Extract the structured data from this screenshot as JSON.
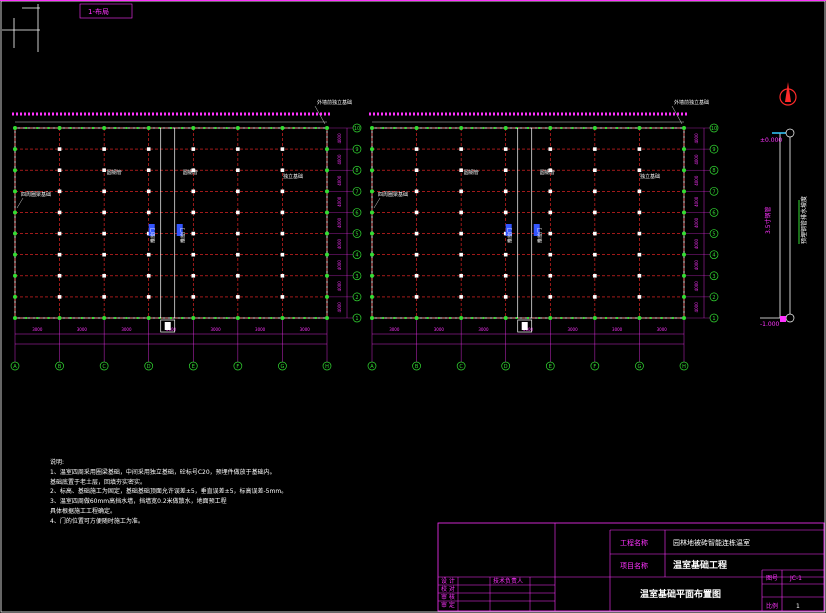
{
  "viewport_tab": "1-布局",
  "plan": {
    "exterior_wall_label": "外墙前独立基础",
    "side_wall_label": "四周圈梁基础",
    "interior_label": "独立基础",
    "column_label": "圆钢管",
    "door_label": "推拉门",
    "row_axes": [
      "10",
      "9",
      "8",
      "7",
      "6",
      "5",
      "4",
      "3",
      "2",
      "1"
    ],
    "col_axes": [
      "A",
      "B",
      "C",
      "D",
      "E",
      "F",
      "G",
      "H"
    ],
    "bay_dims": [
      "3000",
      "3000",
      "3000",
      "3000",
      "3000",
      "3000",
      "3000",
      "3000"
    ],
    "row_dims": [
      "4000",
      "4000",
      "4000",
      "4000",
      "4000",
      "4000",
      "4000",
      "4000",
      "4000"
    ]
  },
  "section": {
    "elev_top": "±0.000",
    "elev_bottom": "-1.000",
    "pipe_label": "3.5寸钢管",
    "slope_label": "预埋钢管排水坡度"
  },
  "notes": {
    "title": "说明:",
    "lines": [
      "1、温室四周采用圈梁基础，中间采用独立基础，砼标号C20，预埋件做放于基础内。",
      "   基础底置于老土层，回填夯实密实。",
      "2、标高、基础施工为固定，基础基础顶面允许误差±5，垂直误差±5，标高误差-5mm。",
      "3、温室四周做60mm高挡水墙，挡墙宽0.2米做散水，地面预工程",
      "   具体根据施工工程确定。",
      "4、门的位置可方便随时施工为准。"
    ]
  },
  "title_block": {
    "project_label": "工程名称",
    "project_value": "园林地被砖智能连栋温室",
    "item_label": "项目名称",
    "item_value": "温室基础工程",
    "drawing_title": "温室基础平面布置图",
    "drawing_no_label": "图号",
    "drawing_no": "JC-1",
    "left_rows": [
      "设 计",
      "校 对",
      "审 核",
      "审 定"
    ],
    "stamp": "技术负责人",
    "sheet_label": "比例",
    "sheet_value": "1"
  },
  "colors": {
    "background": "#000000",
    "grid_red": "#ff2a2a",
    "axis_magenta": "#ff33ff",
    "green": "#33dd33",
    "white": "#ffffff",
    "blue": "#3355ff",
    "cyan": "#33ccff"
  }
}
